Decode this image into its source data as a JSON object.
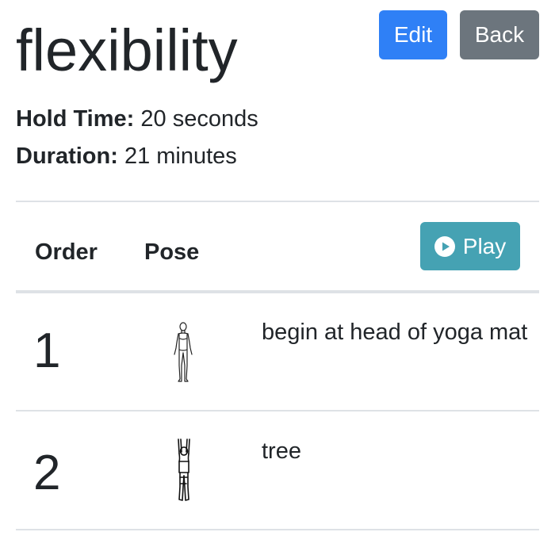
{
  "routine": {
    "title": "flexibility",
    "hold_time_label": "Hold Time:",
    "hold_time_value": "20 seconds",
    "duration_label": "Duration:",
    "duration_value": "21 minutes"
  },
  "actions": {
    "edit_label": "Edit",
    "back_label": "Back",
    "play_label": "Play",
    "play_icon": "play-circle-icon"
  },
  "colors": {
    "edit": "#2f80f6",
    "back": "#6c757d",
    "play": "#45a2b3"
  },
  "table": {
    "headers": {
      "order": "Order",
      "pose": "Pose"
    },
    "rows": [
      {
        "order": "1",
        "pose_icon": "standing-pose-icon",
        "description": "begin at head of yoga mat"
      },
      {
        "order": "2",
        "pose_icon": "tree-pose-icon",
        "description": "tree"
      }
    ]
  }
}
